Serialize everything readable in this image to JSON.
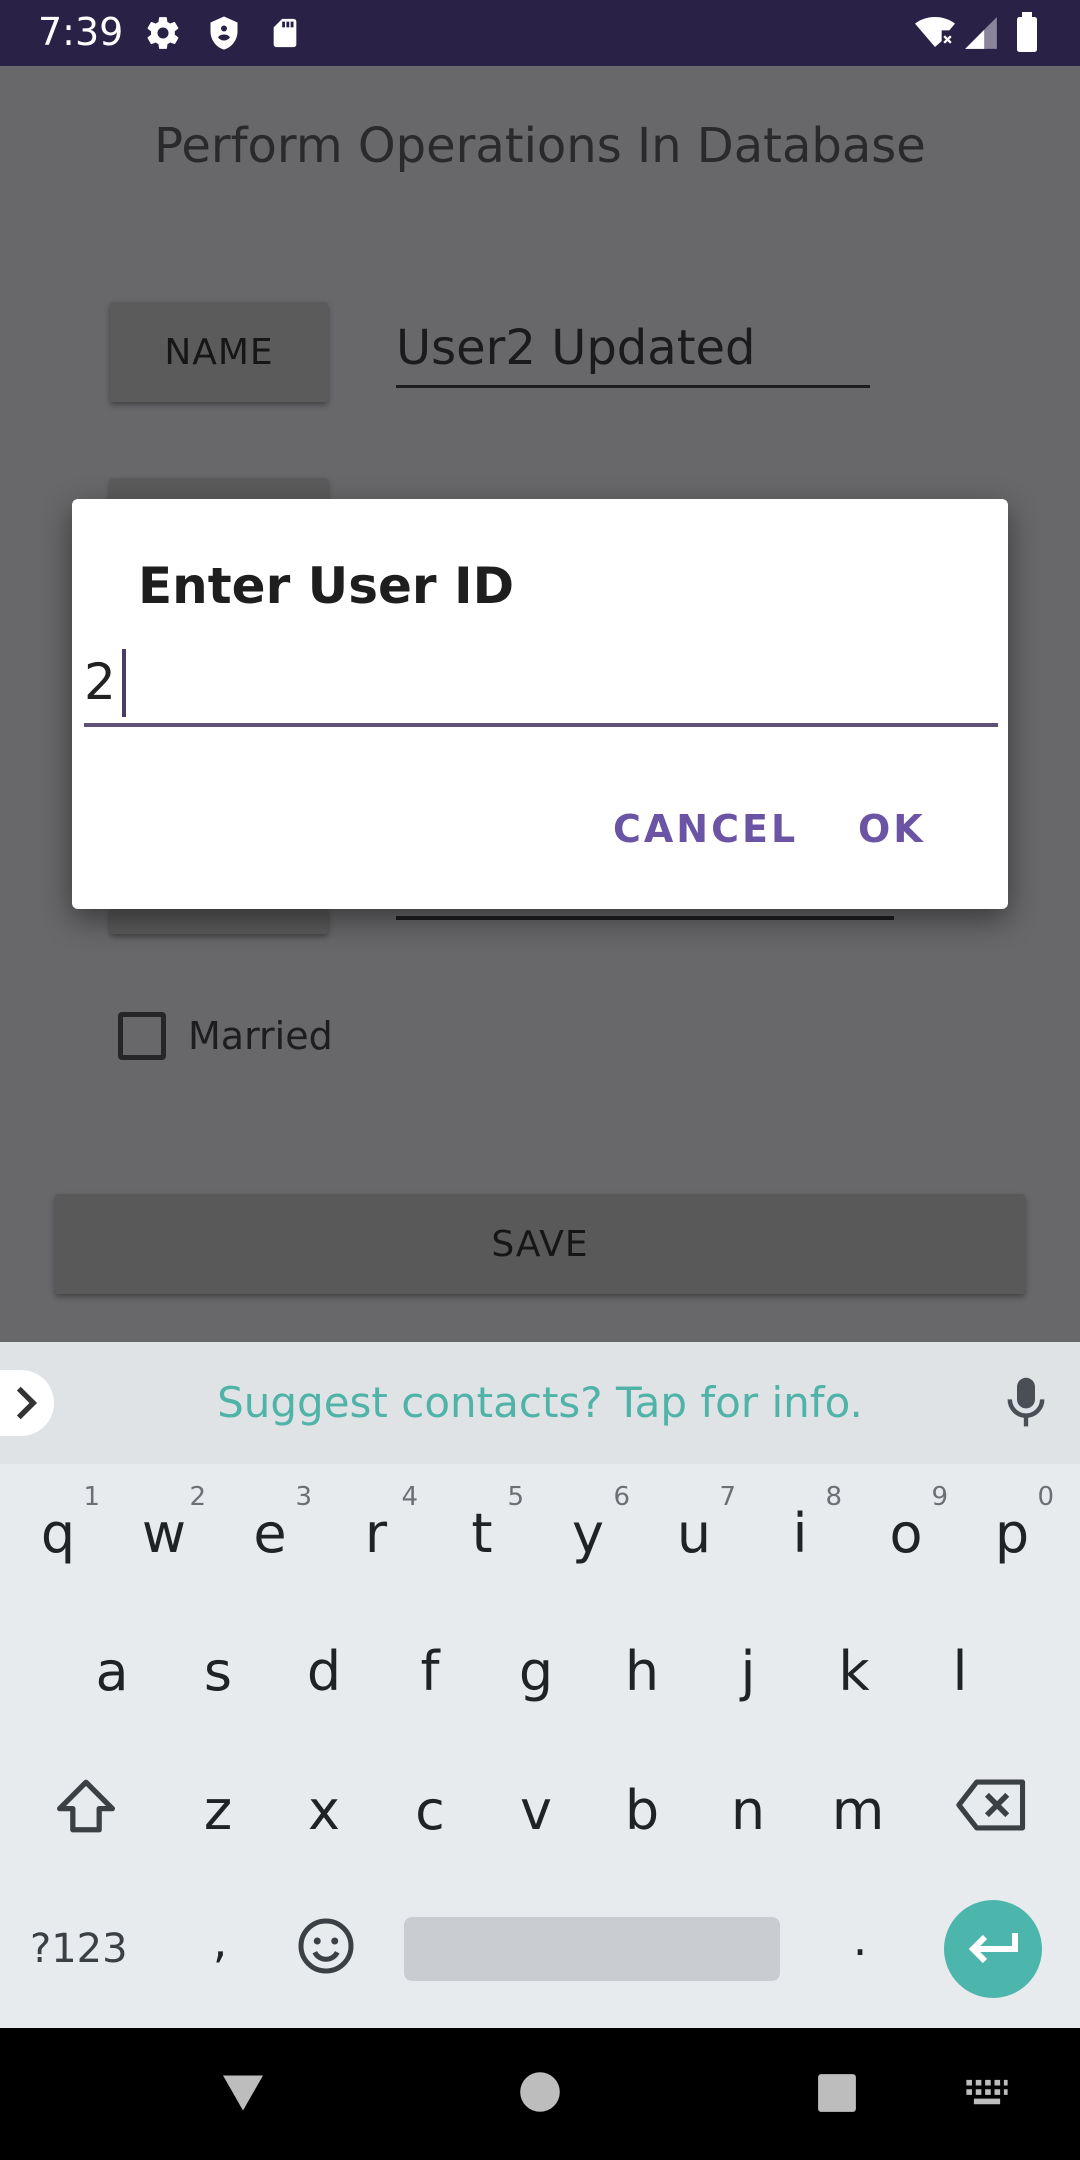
{
  "status_bar": {
    "time": "7:39",
    "icons": [
      "settings-icon",
      "shield-icon",
      "sd-card-icon",
      "wifi-icon",
      "signal-icon",
      "battery-icon"
    ]
  },
  "app": {
    "title": "Perform Operations In Database",
    "name_button": "NAME",
    "name_value": "User2 Updated",
    "married_label": "Married",
    "save_button": "SAVE"
  },
  "dialog": {
    "title": "Enter User ID",
    "input_value": "2",
    "cancel": "CANCEL",
    "ok": "OK"
  },
  "keyboard": {
    "suggestion": "Suggest contacts? Tap for info.",
    "row1": [
      {
        "k": "q",
        "h": "1"
      },
      {
        "k": "w",
        "h": "2"
      },
      {
        "k": "e",
        "h": "3"
      },
      {
        "k": "r",
        "h": "4"
      },
      {
        "k": "t",
        "h": "5"
      },
      {
        "k": "y",
        "h": "6"
      },
      {
        "k": "u",
        "h": "7"
      },
      {
        "k": "i",
        "h": "8"
      },
      {
        "k": "o",
        "h": "9"
      },
      {
        "k": "p",
        "h": "0"
      }
    ],
    "row2": [
      "a",
      "s",
      "d",
      "f",
      "g",
      "h",
      "j",
      "k",
      "l"
    ],
    "row3": [
      "z",
      "x",
      "c",
      "v",
      "b",
      "n",
      "m"
    ],
    "symbols_key": "?123",
    "comma_key": ",",
    "period_key": "."
  },
  "colors": {
    "accent": "#6b54a4",
    "enter": "#4db6ac",
    "suggestion": "#4fb3a8",
    "status_bar": "#2a2147"
  }
}
